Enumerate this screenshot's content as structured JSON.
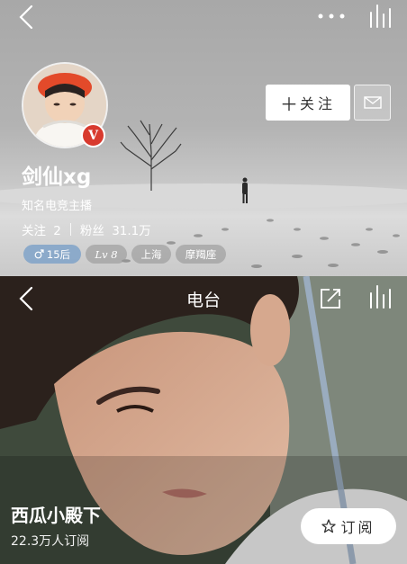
{
  "profile": {
    "username": "剑仙xg",
    "bio": "知名电竞主播",
    "badge": "V",
    "follow_label": "关注",
    "stats": {
      "following_label": "关注",
      "following_count": "2",
      "fans_label": "粉丝",
      "fans_count": "31.1万"
    },
    "tags": {
      "age": "15后",
      "level": "Lv 8",
      "city": "上海",
      "zodiac": "摩羯座"
    }
  },
  "radio": {
    "header_title": "电台",
    "name": "西瓜小殿下",
    "subscribers": "22.3万人订阅",
    "subscribe_label": "订阅"
  },
  "icons": {
    "back": "chevron-left-icon",
    "more": "more-dots-icon",
    "playing": "playing-bars-icon",
    "message": "envelope-icon",
    "share": "share-icon",
    "star": "star-icon"
  },
  "colors": {
    "badge_red": "#d83a2e",
    "age_tag_blue": "#7aa0c8"
  }
}
